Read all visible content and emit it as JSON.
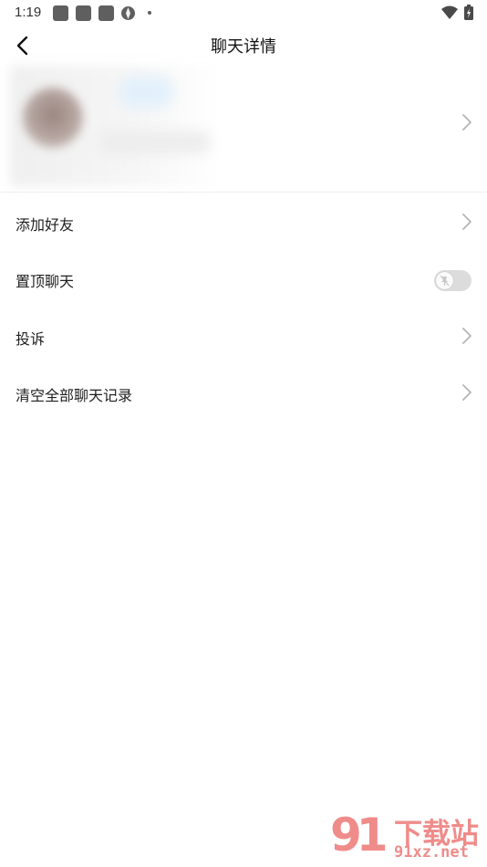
{
  "status_bar": {
    "time": "1:19"
  },
  "header": {
    "title": "聊天详情"
  },
  "menu": {
    "items": [
      {
        "label": "添加好友",
        "control": "chevron"
      },
      {
        "label": "置顶聊天",
        "control": "toggle",
        "enabled": false
      },
      {
        "label": "投诉",
        "control": "chevron"
      },
      {
        "label": "清空全部聊天记录",
        "control": "chevron"
      }
    ]
  },
  "watermark": {
    "logo_text": "91",
    "brand_text": "下载站",
    "site_text": "91xz.net"
  },
  "colors": {
    "background": "#ffffff",
    "text": "#1f1f1f",
    "chevron": "#b5b5b5",
    "toggle_off": "#dcdcdc",
    "watermark": "#ef8c8a"
  }
}
